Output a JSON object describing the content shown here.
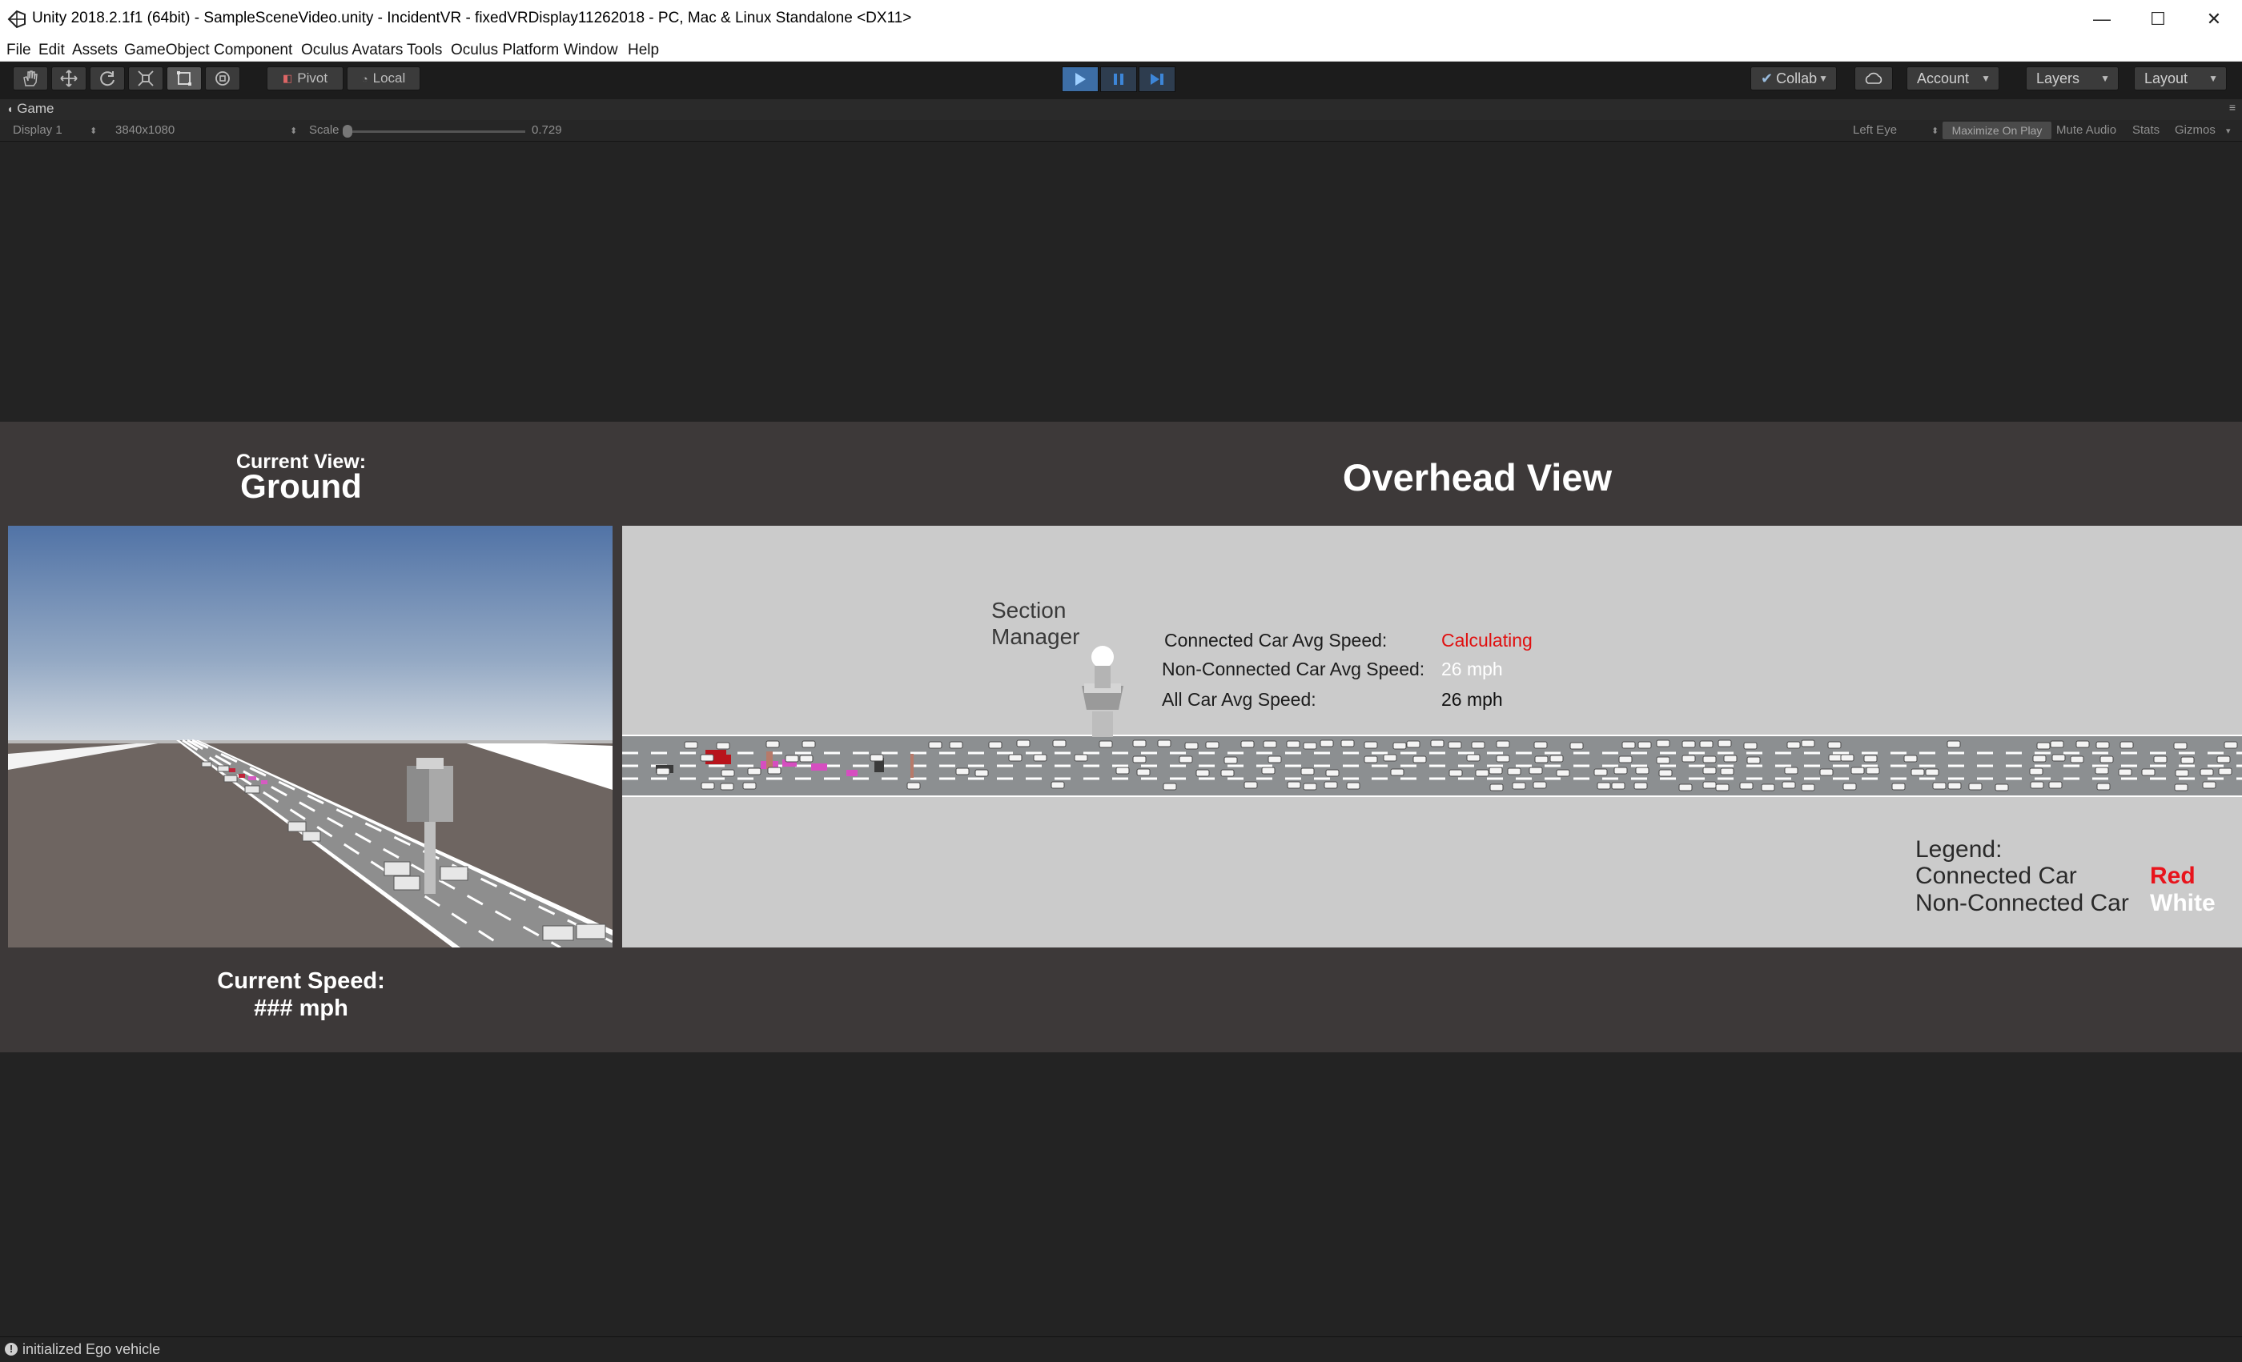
{
  "window": {
    "title": "Unity 2018.2.1f1 (64bit) - SampleSceneVideo.unity - IncidentVR - fixedVRDisplay11262018 - PC, Mac & Linux Standalone <DX11>",
    "minimize": "—",
    "maximize": "☐",
    "close": "✕"
  },
  "menu": [
    "File",
    "Edit",
    "Assets",
    "GameObject",
    "Component",
    "Oculus Avatars",
    "Tools",
    "Oculus Platform",
    "Window",
    "Help"
  ],
  "toolbar": {
    "tools": [
      "hand-tool",
      "move-tool",
      "rotate-tool",
      "scale-tool",
      "rect-tool",
      "transform-tool"
    ],
    "pivot_label": "Pivot",
    "local_label": "Local",
    "collab_label": "Collab",
    "account_label": "Account",
    "layers_label": "Layers",
    "layout_label": "Layout"
  },
  "game_panel": {
    "tab_label": "Game",
    "display": "Display 1",
    "resolution": "3840x1080",
    "scale_label": "Scale",
    "scale_value": "0.729",
    "eye": "Left Eye",
    "maximize_on_play": "Maximize On Play",
    "mute_audio": "Mute Audio",
    "stats": "Stats",
    "gizmos": "Gizmos"
  },
  "hud": {
    "current_view_label": "Current View:",
    "current_view_value": "Ground",
    "overhead_title": "Overhead View",
    "current_speed_label": "Current Speed:",
    "current_speed_value": "### mph",
    "section_manager_line1": "Section",
    "section_manager_line2": "Manager",
    "connected_label": "Connected Car Avg Speed:",
    "connected_value": "Calculating",
    "non_connected_label": "Non-Connected Car Avg Speed:",
    "non_connected_value": "26 mph",
    "all_label": "All Car Avg Speed:",
    "all_value": "26 mph",
    "legend_title": "Legend:",
    "legend_connected_label": "Connected Car",
    "legend_connected_value": "Red",
    "legend_non_connected_label": "Non-Connected Car",
    "legend_non_connected_value": "White"
  },
  "colors": {
    "connected": "#e8141c",
    "non_connected": "#ffffff",
    "calculating": "#e01010"
  },
  "status": {
    "message": "initialized Ego vehicle"
  }
}
